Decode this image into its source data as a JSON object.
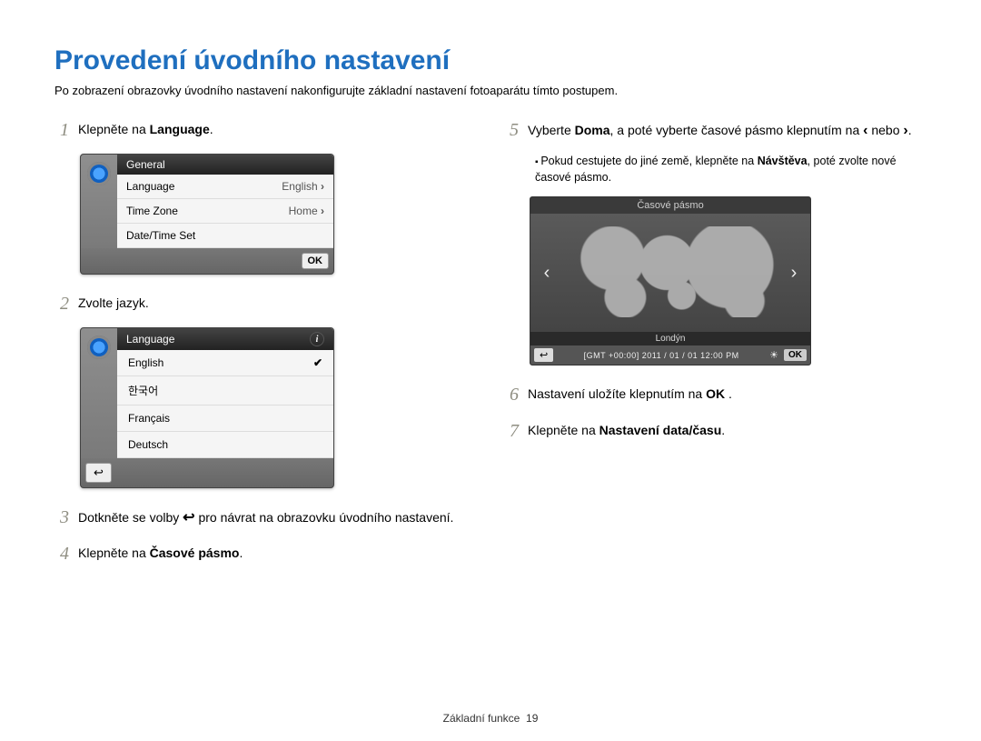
{
  "title": "Provedení úvodního nastavení",
  "subtitle": "Po zobrazení obrazovky úvodního nastavení nakonfigurujte základní nastavení fotoaparátu tímto postupem.",
  "steps": {
    "s1": {
      "num": "1",
      "pre": "Klepněte na ",
      "bold": "Language",
      "post": "."
    },
    "s2": {
      "num": "2",
      "text": "Zvolte jazyk."
    },
    "s3": {
      "num": "3",
      "pre": "Dotkněte se volby ",
      "post": " pro návrat na obrazovku úvodního nastavení."
    },
    "s4": {
      "num": "4",
      "pre": "Klepněte na ",
      "bold": "Časové pásmo",
      "post": "."
    },
    "s5": {
      "num": "5",
      "pre": "Vyberte ",
      "bold": "Doma",
      "mid": ", a poté vyberte časové pásmo klepnutím na ",
      "post": " nebo ",
      "end": "."
    },
    "s5b": {
      "pre": "Pokud cestujete do jiné země, klepněte na ",
      "bold": "Návštěva",
      "post": ", poté zvolte nové časové pásmo."
    },
    "s6": {
      "num": "6",
      "pre": "Nastavení uložíte klepnutím na ",
      "ok": "OK",
      "post": " ."
    },
    "s7": {
      "num": "7",
      "pre": "Klepněte na ",
      "bold": "Nastavení data/času",
      "post": "."
    }
  },
  "device1": {
    "header": "General",
    "rows": [
      {
        "label": "Language",
        "value": "English"
      },
      {
        "label": "Time Zone",
        "value": "Home"
      },
      {
        "label": "Date/Time Set",
        "value": ""
      }
    ],
    "ok": "OK"
  },
  "device2": {
    "header": "Language",
    "rows": [
      "English",
      "한국어",
      "Français",
      "Deutsch"
    ],
    "back": "↩"
  },
  "tz": {
    "header": "Časové pásmo",
    "city": "Londýn",
    "gmt": "[GMT +00:00]   2011 / 01 / 01   12:00 PM",
    "back": "↩",
    "ok": "OK"
  },
  "footer": {
    "label": "Základní funkce",
    "page": "19"
  }
}
